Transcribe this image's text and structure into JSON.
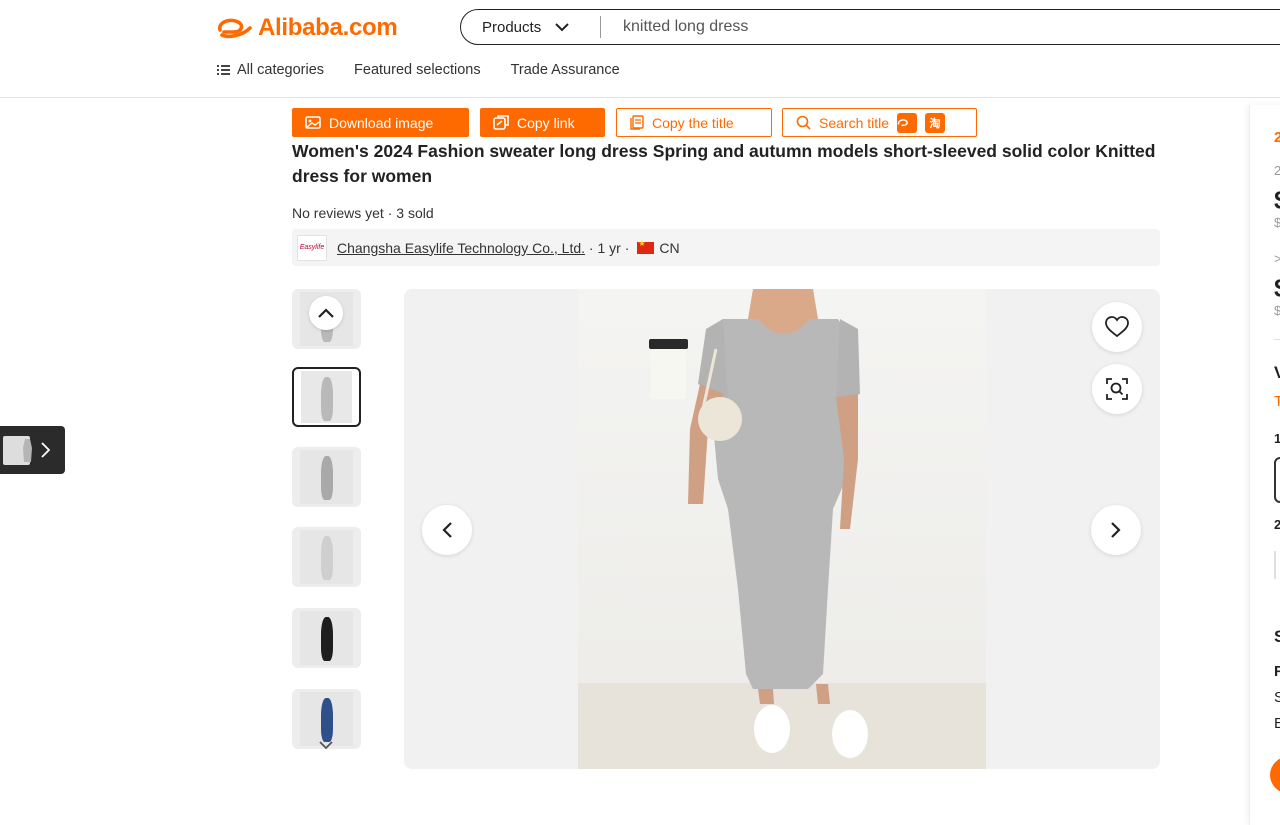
{
  "header": {
    "logo_text": "Alibaba.com",
    "search": {
      "category": "Products",
      "query": "knitted long dress"
    },
    "subnav": [
      "All categories",
      "Featured selections",
      "Trade Assurance"
    ]
  },
  "actions": {
    "download_image": "Download image",
    "copy_link": "Copy link",
    "copy_title": "Copy the title",
    "search_title": "Search title",
    "badge_taobao": "淘"
  },
  "product": {
    "title": "Women's 2024 Fashion sweater long dress Spring and autumn models short-sleeved solid color Knitted dress for women",
    "reviews": "No reviews yet",
    "sold": "3 sold",
    "supplier": {
      "logo_text": "Easylife",
      "name": "Changsha Easylife Technology Co., Ltd.",
      "years": "1 yr",
      "country": "CN"
    }
  },
  "gallery": {
    "selected_index": 1,
    "thumbnails": [
      {
        "dress_color": "#b9b9b9"
      },
      {
        "dress_color": "#b9b9b9"
      },
      {
        "dress_color": "#a9a9a9"
      },
      {
        "dress_color": "#cfcfcf"
      },
      {
        "dress_color": "#1e1e1e"
      },
      {
        "dress_color": "#2f4f8a"
      }
    ]
  },
  "right_panel": {
    "line_1": "2",
    "line_2": "2",
    "price_1": "$",
    "old_1": "$",
    "line_3": ">",
    "price_2": "$",
    "old_2": "$",
    "line_4": "V",
    "line_5": "T",
    "line_6": "1",
    "line_7": "2",
    "line_8": "S",
    "line_9": "F",
    "line_10": "S",
    "line_11": "E"
  },
  "colors": {
    "brand": "#ff6a00",
    "text": "#222222",
    "muted": "#999999",
    "surface": "#f4f4f4"
  }
}
